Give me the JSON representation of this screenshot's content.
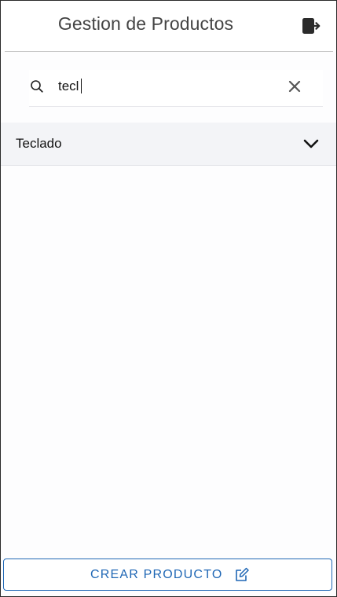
{
  "header": {
    "title": "Gestion de Productos",
    "logout_icon": "logout-icon"
  },
  "search": {
    "value": "tecl",
    "search_icon": "search-icon",
    "clear_icon": "close-icon"
  },
  "results": [
    {
      "label": "Teclado",
      "expand_icon": "chevron-down-icon"
    }
  ],
  "footer": {
    "create_label": "CREAR PRODUCTO",
    "create_icon": "edit-icon"
  },
  "colors": {
    "accent": "#1f67b5",
    "row_background": "#f3f4f7",
    "title_text": "#444444"
  }
}
